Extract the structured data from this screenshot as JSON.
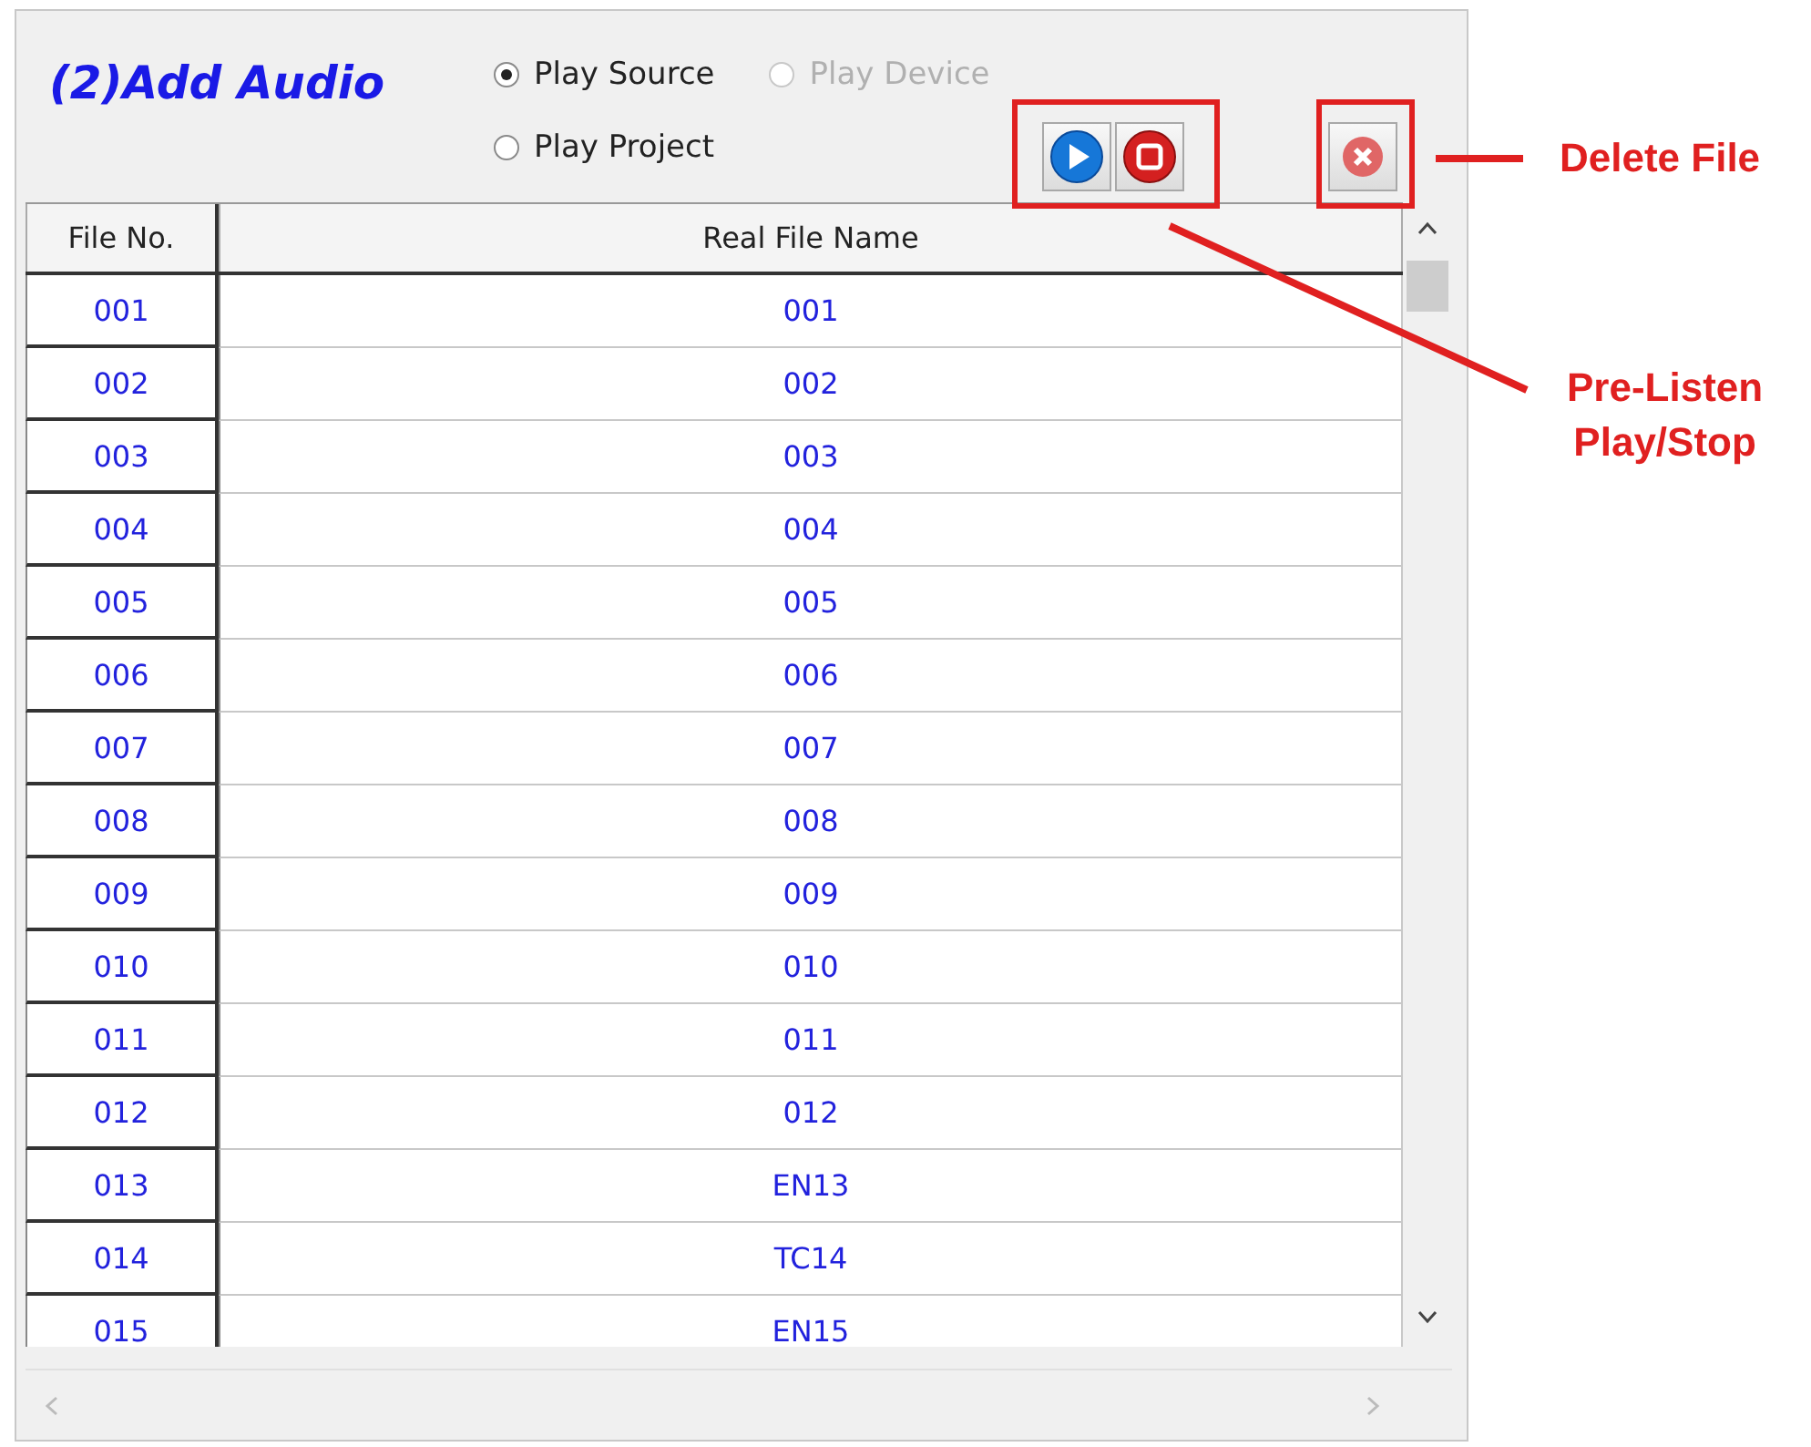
{
  "panel": {
    "title": "(2)Add Audio",
    "play_options": [
      {
        "label": "Play Source",
        "selected": true,
        "disabled": false
      },
      {
        "label": "Play Device",
        "selected": false,
        "disabled": true
      },
      {
        "label": "Play Project",
        "selected": false,
        "disabled": false
      }
    ]
  },
  "table": {
    "columns": [
      "File No.",
      "Real File Name"
    ],
    "rows": [
      [
        "001",
        "001"
      ],
      [
        "002",
        "002"
      ],
      [
        "003",
        "003"
      ],
      [
        "004",
        "004"
      ],
      [
        "005",
        "005"
      ],
      [
        "006",
        "006"
      ],
      [
        "007",
        "007"
      ],
      [
        "008",
        "008"
      ],
      [
        "009",
        "009"
      ],
      [
        "010",
        "010"
      ],
      [
        "011",
        "011"
      ],
      [
        "012",
        "012"
      ],
      [
        "013",
        "EN13"
      ],
      [
        "014",
        "TC14"
      ],
      [
        "015",
        "EN15"
      ]
    ]
  },
  "annotations": [
    {
      "label": "Delete File"
    },
    {
      "label": "Pre-Listen\nPlay/Stop"
    }
  ]
}
